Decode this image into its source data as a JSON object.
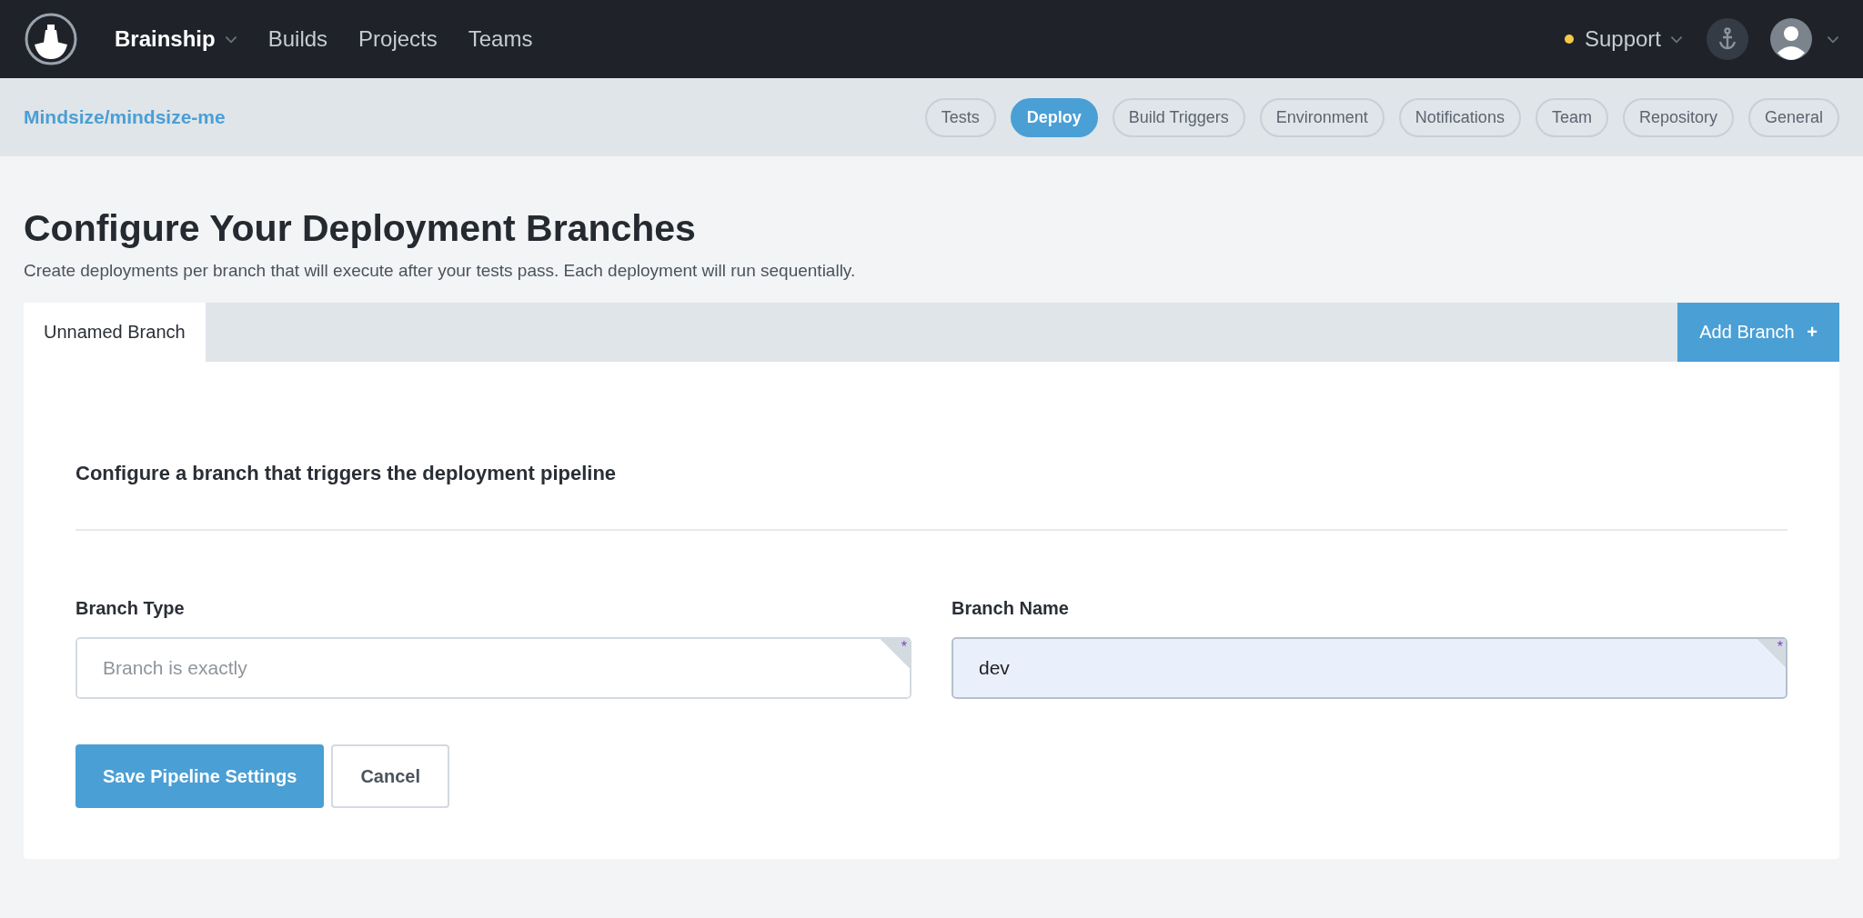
{
  "topbar": {
    "org": "Brainship",
    "nav": [
      "Builds",
      "Projects",
      "Teams"
    ],
    "support": {
      "label": "Support",
      "color": "#f5c945"
    }
  },
  "subbar": {
    "repo": "Mindsize/mindsize-me",
    "tabs": [
      {
        "label": "Tests",
        "selected": false
      },
      {
        "label": "Deploy",
        "selected": true
      },
      {
        "label": "Build Triggers",
        "selected": false
      },
      {
        "label": "Environment",
        "selected": false
      },
      {
        "label": "Notifications",
        "selected": false
      },
      {
        "label": "Team",
        "selected": false
      },
      {
        "label": "Repository",
        "selected": false
      },
      {
        "label": "General",
        "selected": false
      }
    ]
  },
  "page": {
    "title": "Configure Your Deployment Branches",
    "subtitle": "Create deployments per branch that will execute after your tests pass. Each deployment will run sequentially."
  },
  "branch_tabs": [
    {
      "label": "Unnamed Branch",
      "selected": true
    }
  ],
  "add_branch": {
    "label": "Add Branch",
    "icon": "+"
  },
  "form": {
    "heading": "Configure a branch that triggers the deployment pipeline",
    "fields": [
      {
        "label": "Branch Type",
        "placeholder": "Branch is exactly",
        "required_mark": "*",
        "focused": false
      },
      {
        "label": "Branch Name",
        "value": "dev",
        "required_mark": "*",
        "focused": true
      }
    ],
    "buttons": [
      {
        "label": "Save Pipeline Settings",
        "kind": "primary"
      },
      {
        "label": "Cancel",
        "kind": "secondary"
      }
    ]
  }
}
